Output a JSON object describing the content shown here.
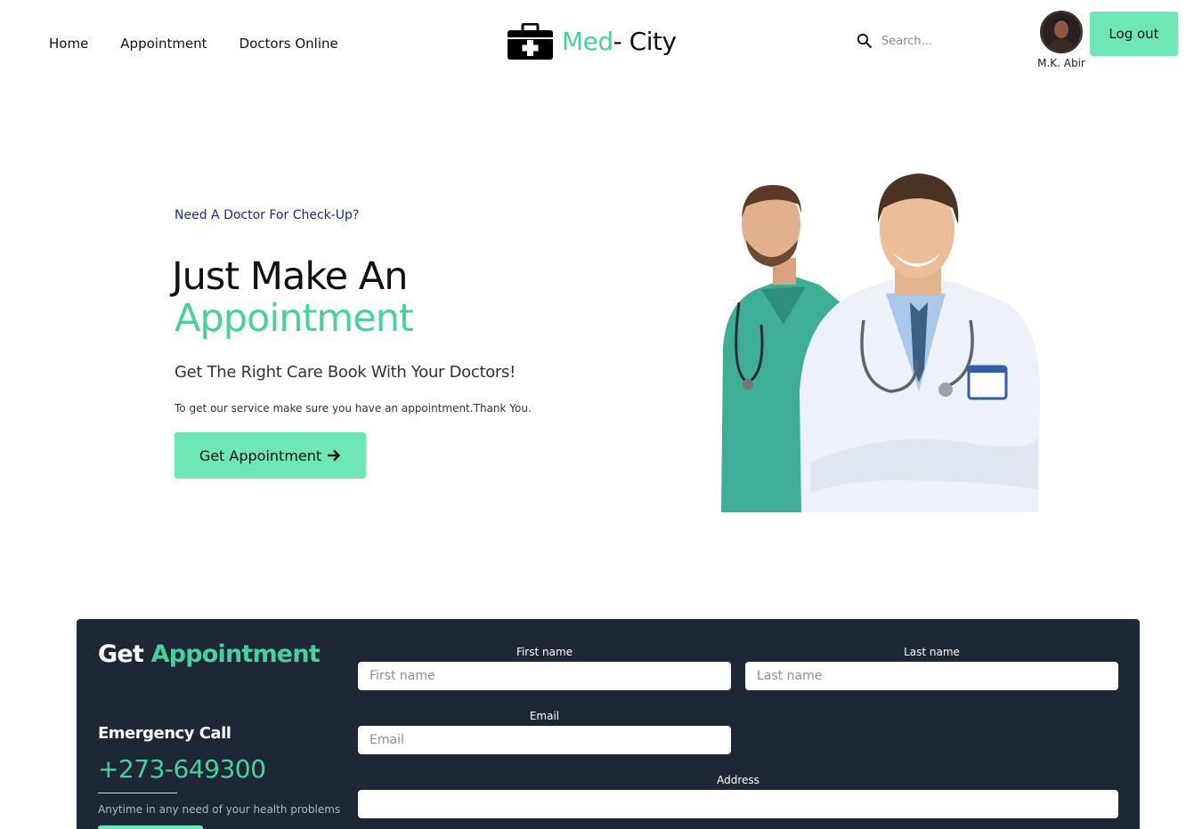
{
  "nav": {
    "links": [
      "Home",
      "Appointment",
      "Doctors Online"
    ],
    "logo_part1": "Med",
    "logo_part2": "- City",
    "search_placeholder": "Search...",
    "user_name": "M.K. Abir",
    "logout_label": "Log out"
  },
  "hero": {
    "kicker": "Need A Doctor For Check-Up?",
    "title_line1": "Just Make An",
    "title_line2": "Appointment",
    "subtitle": "Get The Right Care Book With Your Doctors!",
    "description": "To get our service make sure you have an appointment.Thank You.",
    "button_label": "Get Appointment"
  },
  "appointment": {
    "title_part1": "Get",
    "title_part2": "Appointment",
    "emergency_title": "Emergency Call",
    "emergency_phone": "+273-649300",
    "emergency_note": "Anytime in any need of your health problems",
    "fields": {
      "first_name_label": "First name",
      "first_name_placeholder": "First name",
      "last_name_label": "Last name",
      "last_name_placeholder": "Last name",
      "email_label": "Email",
      "email_placeholder": "Email",
      "address_label": "Address",
      "address_placeholder": ""
    }
  },
  "colors": {
    "accent": "#46d39a",
    "button": "#6ee7b7",
    "panel_bg": "#1e2736",
    "kicker": "#1e2a78"
  },
  "icons": [
    "medical-kit-icon",
    "search-icon",
    "arrow-right-icon"
  ]
}
